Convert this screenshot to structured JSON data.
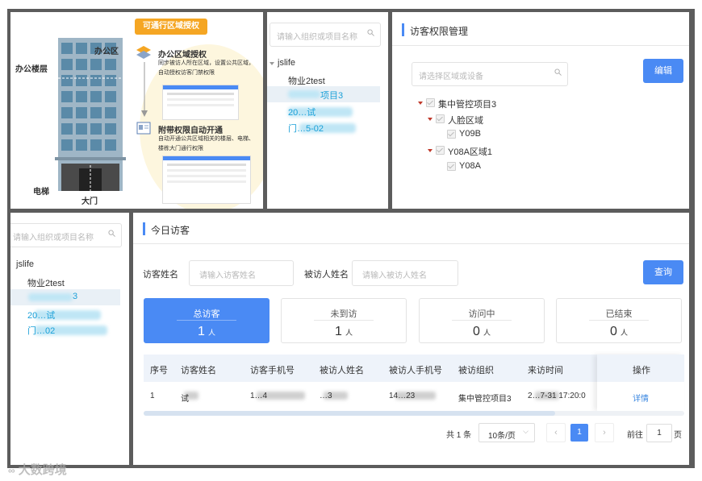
{
  "illustration": {
    "badge": "可通行区域授权",
    "label_office_floor": "办公楼层",
    "label_office_area": "办公区",
    "label_elevator": "电梯",
    "label_gate": "大门",
    "step1_title": "办公区域授权",
    "step1_desc": "同步被访人所在区域，设置公共区域，自动授权访客门禁权限",
    "step2_title": "附带权限自动开通",
    "step2_desc": "自动开通公共区域相关的楼层、电梯、楼栋大门通行权限"
  },
  "org_tree_top": {
    "search_placeholder": "请输入组织或项目名称",
    "root": "jslife",
    "items": [
      "物业2test",
      "项目3",
      "20…试",
      "门…5-02"
    ]
  },
  "permission_panel": {
    "title": "访客权限管理",
    "search_placeholder": "请选择区域或设备",
    "edit_button": "编辑",
    "tree": {
      "root": "集中管控项目3",
      "area1": "人脸区域",
      "device1": "Y09B",
      "area2": "Y08A区域1",
      "device2": "Y08A"
    }
  },
  "org_tree_bottom": {
    "search_placeholder": "请输入组织或项目名称",
    "root": "jslife",
    "items": [
      "物业2test",
      "3",
      "20…试",
      "门…02"
    ]
  },
  "today_visitors": {
    "title": "今日访客",
    "visitor_name_label": "访客姓名",
    "visitor_name_placeholder": "请输入访客姓名",
    "host_name_label": "被访人姓名",
    "host_name_placeholder": "请输入被访人姓名",
    "query_button": "查询",
    "stats": [
      {
        "label": "总访客",
        "value": "1",
        "unit": "人"
      },
      {
        "label": "未到访",
        "value": "1",
        "unit": "人"
      },
      {
        "label": "访问中",
        "value": "0",
        "unit": "人"
      },
      {
        "label": "已结束",
        "value": "0",
        "unit": "人"
      }
    ],
    "columns": [
      "序号",
      "访客姓名",
      "访客手机号",
      "被访人姓名",
      "被访人手机号",
      "被访组织",
      "来访时间",
      "操作"
    ],
    "rows": [
      {
        "index": "1",
        "visitor": "试",
        "phone": "1…4",
        "host": "…3",
        "host_phone": "14…23",
        "org": "集中管控项目3",
        "time": "2…7-31 17:20:0",
        "action": "详情"
      }
    ],
    "pagination": {
      "total": "共 1 条",
      "page_size": "10条/页",
      "current_page": "1",
      "goto_label": "前往",
      "goto_value": "1",
      "page_unit": "页"
    }
  },
  "watermark": "大数跨境",
  "colors": {
    "accent": "#4a8af4",
    "frame": "#5c5c5c",
    "badge": "#f5a623"
  }
}
